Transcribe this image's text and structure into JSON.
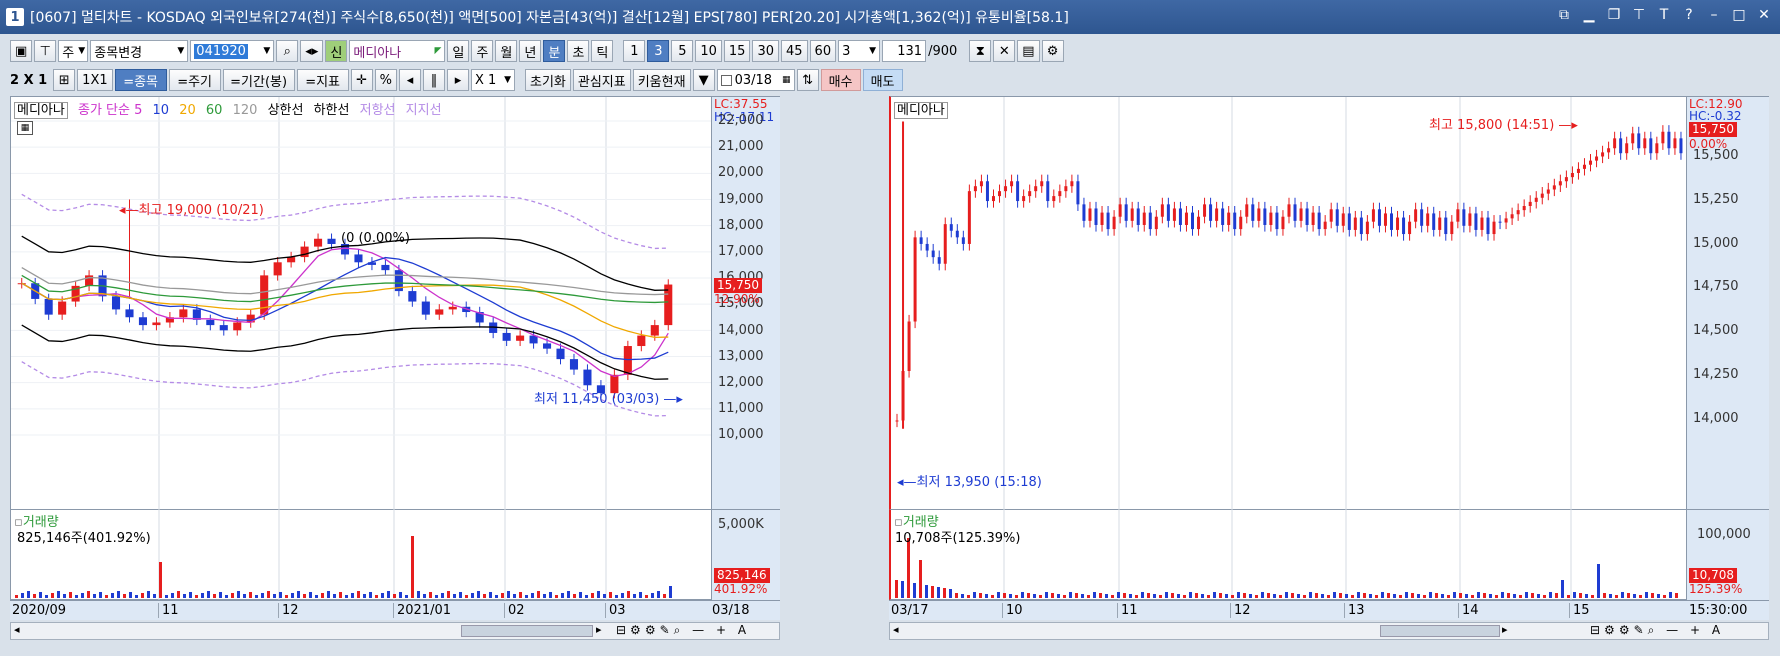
{
  "window": {
    "number": "1",
    "title": "[0607] 멀티차트 - KOSDAQ 외국인보유[274(천)] 주식수[8,650(천)] 액면[500] 자본금[43(억)] 결산[12월] EPS[780] PER[20.20] 시가총액[1,362(억)] 유통비율[58.1]"
  },
  "toolbar1": {
    "ju": "주",
    "stock_change": "종목변경",
    "code": "041920",
    "mode": "신",
    "stock_name": "메디아나",
    "periods": [
      "일",
      "주",
      "월",
      "년",
      "분",
      "초",
      "틱"
    ],
    "active_period": "분",
    "intervals": [
      "1",
      "3",
      "5",
      "10",
      "15",
      "30",
      "45",
      "60"
    ],
    "active_interval": "3",
    "count_sel": "3",
    "bars": "131",
    "bars_max": "/900"
  },
  "toolbar2": {
    "layout": "2 X 1",
    "one": "1X1",
    "jong": "=종목",
    "jugi": "=주기",
    "gigan": "=기간(봉)",
    "jipyo": "=지표",
    "zoom": "X 1",
    "reset": "초기화",
    "interest": "관심지표",
    "kiwoom": "키움현재",
    "date": "03/18",
    "buy": "매수",
    "sell": "매도"
  },
  "left": {
    "name": "메디아나",
    "legend": {
      "close": "종가 단순",
      "ma5": "5",
      "ma10": "10",
      "ma20": "20",
      "ma60": "60",
      "ma120": "120",
      "upper": "상한선",
      "lower": "하한선",
      "resist": "저항선",
      "support": "지지선"
    },
    "lc": "LC:37.55",
    "hc": "HC:-17.11",
    "price_tag": "15,750",
    "pct_tag": "12.90%",
    "high_note": "최고 19,000 (10/21)",
    "low_note": "최저 11,450 (03/03)",
    "mid_note": "0 (0.00%)",
    "mid_prefix": "(",
    "yticks": [
      "22,000",
      "21,000",
      "20,000",
      "19,000",
      "18,000",
      "17,000",
      "16,000",
      "15,000",
      "14,000",
      "13,000",
      "12,000",
      "11,000",
      "10,000"
    ],
    "vol_title": "거래량",
    "vol_value": "825,146주(401.92%)",
    "vol_tick": "5,000K",
    "vol_tag": "825,146",
    "vol_pct": "401.92%",
    "xticks": [
      "2020/09",
      "11",
      "12",
      "2021/01",
      "02",
      "03"
    ],
    "xend": "03/18"
  },
  "right": {
    "name": "메디아나",
    "lc": "LC:12.90",
    "hc": "HC:-0.32",
    "price_tag": "15,750",
    "pct_tag": "0.00%",
    "high_note": "최고 15,800 (14:51)",
    "low_note": "최저 13,950 (15:18)",
    "yticks": [
      "15,500",
      "15,250",
      "15,000",
      "14,750",
      "14,500",
      "14,250",
      "14,000"
    ],
    "vol_title": "거래량",
    "vol_value": "10,708주(125.39%)",
    "vol_tick": "100,000",
    "vol_tag": "10,708",
    "vol_pct": "125.39%",
    "xticks": [
      "03/17",
      "10",
      "11",
      "12",
      "13",
      "14",
      "15"
    ],
    "xend": "15:30:00"
  },
  "colors": {
    "up": "#e61e1e",
    "down": "#1e3cd2",
    "ma5": "#cc33cc",
    "ma10": "#1e3cd2",
    "ma20": "#f0a800",
    "ma60": "#2e9a3a",
    "ma120": "#999999",
    "band": "#000000",
    "title": "#2e5690"
  },
  "chart_data": [
    {
      "type": "candlestick",
      "title": "메디아나",
      "period": "일",
      "y_range": [
        10000,
        22000
      ],
      "high": {
        "value": 19000,
        "date": "10/21"
      },
      "low": {
        "value": 11450,
        "date": "03/03"
      },
      "last": 15750,
      "close_series": [
        15800,
        15200,
        14600,
        15100,
        15700,
        16100,
        15300,
        14800,
        14500,
        14200,
        14300,
        14500,
        14800,
        14400,
        14200,
        14000,
        14300,
        14600,
        16100,
        16600,
        16800,
        17200,
        17500,
        17300,
        16900,
        16600,
        16500,
        16300,
        15500,
        15100,
        14600,
        14800,
        14900,
        14700,
        14300,
        13900,
        13600,
        13800,
        13500,
        13300,
        12900,
        12500,
        11900,
        11600,
        12300,
        13400,
        13800,
        14200,
        15750
      ],
      "volume_max": 5000000,
      "volume_last": 825146
    },
    {
      "type": "candlestick",
      "title": "메디아나",
      "period": "3분",
      "y_range": [
        13900,
        15900
      ],
      "high": {
        "value": 15800,
        "time": "14:51"
      },
      "low": {
        "value": 13950,
        "time": "15:18"
      },
      "last": 15750,
      "volume_max": 100000,
      "volume_last": 10708
    }
  ]
}
